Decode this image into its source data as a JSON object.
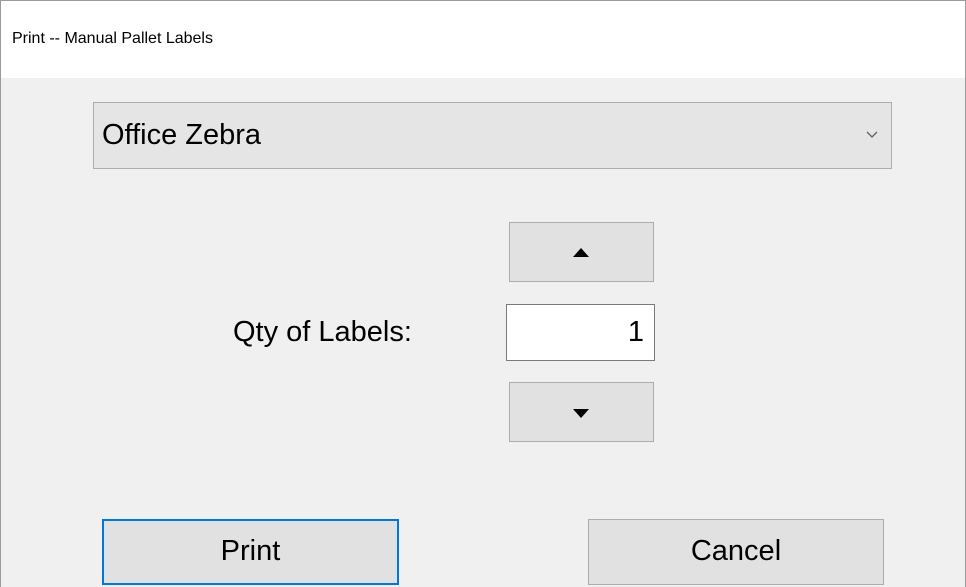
{
  "window": {
    "title": "Print -- Manual Pallet Labels"
  },
  "printer_select": {
    "selected": "Office Zebra",
    "arrow_icon": "chevron-down-icon"
  },
  "quantity": {
    "label": "Qty of Labels:",
    "value": "1",
    "increment_icon": "triangle-up-icon",
    "decrement_icon": "triangle-down-icon"
  },
  "actions": {
    "print_label": "Print",
    "cancel_label": "Cancel"
  },
  "colors": {
    "background": "#f0f0f0",
    "button_face": "#e1e1e1",
    "focus_border": "#0078d7"
  }
}
